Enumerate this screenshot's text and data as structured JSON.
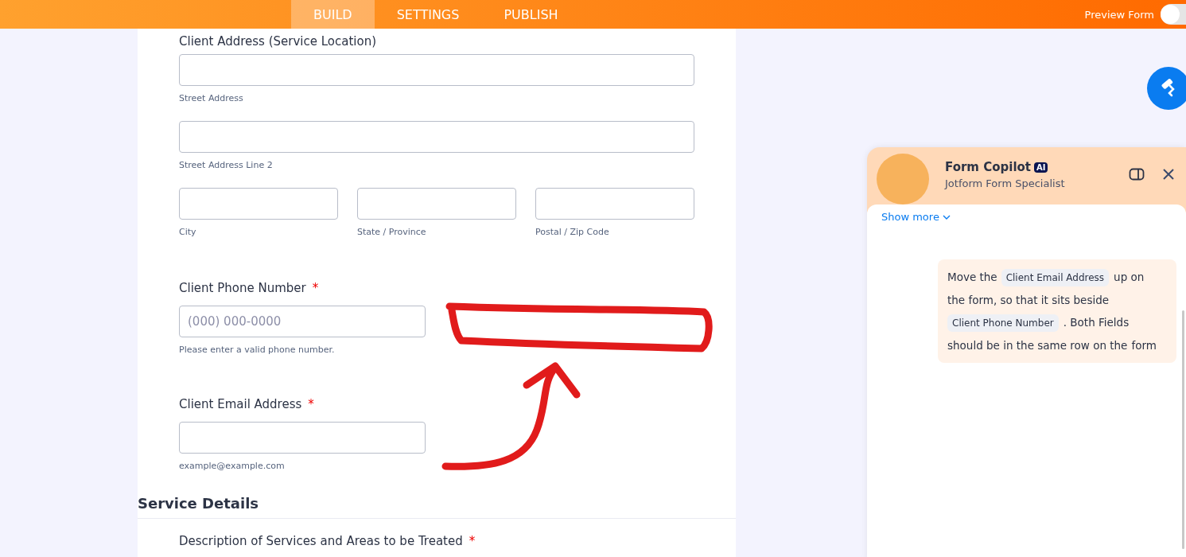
{
  "topbar": {
    "tabs": [
      {
        "label": "BUILD",
        "selected": true
      },
      {
        "label": "SETTINGS",
        "selected": false
      },
      {
        "label": "PUBLISH",
        "selected": false
      }
    ],
    "preview": {
      "label": "Preview Form",
      "on": false
    }
  },
  "form": {
    "address_label": "Client Address (Service Location)",
    "address_rows": [
      [
        {
          "sublabel": "Street Address"
        }
      ],
      [
        {
          "sublabel": "Street Address Line 2"
        }
      ],
      [
        {
          "sublabel": "City"
        },
        {
          "sublabel": "State / Province"
        },
        {
          "sublabel": "Postal / Zip Code"
        }
      ]
    ],
    "fields": [
      {
        "label": "Client Phone Number",
        "required_mark": "*",
        "placeholder": "(000) 000-0000",
        "hint": "Please enter a valid phone number."
      },
      {
        "label": "Client Email Address",
        "required_mark": "*",
        "hint": "example@example.com"
      }
    ],
    "section": {
      "title": "Service Details",
      "next_field": {
        "label": "Description of Services and Areas to be Treated",
        "required_mark": "*"
      }
    }
  },
  "copilot": {
    "title": "Form Copilot",
    "badge": "AI",
    "subtitle": "Jotform Form Specialist",
    "show_more": "Show more",
    "message": [
      {
        "kind": "text",
        "text": "Move the"
      },
      {
        "kind": "chip",
        "text": "Client Email Address"
      },
      {
        "kind": "text",
        "text": "up on"
      },
      {
        "kind": "text",
        "text": "the form, so that it sits beside"
      },
      {
        "kind": "chip",
        "text": "Client Phone Number"
      },
      {
        "kind": "text",
        "text": ". Both Fields"
      },
      {
        "kind": "text",
        "text": "should be in the same row on the"
      },
      {
        "kind": "text",
        "text": "form"
      }
    ]
  }
}
